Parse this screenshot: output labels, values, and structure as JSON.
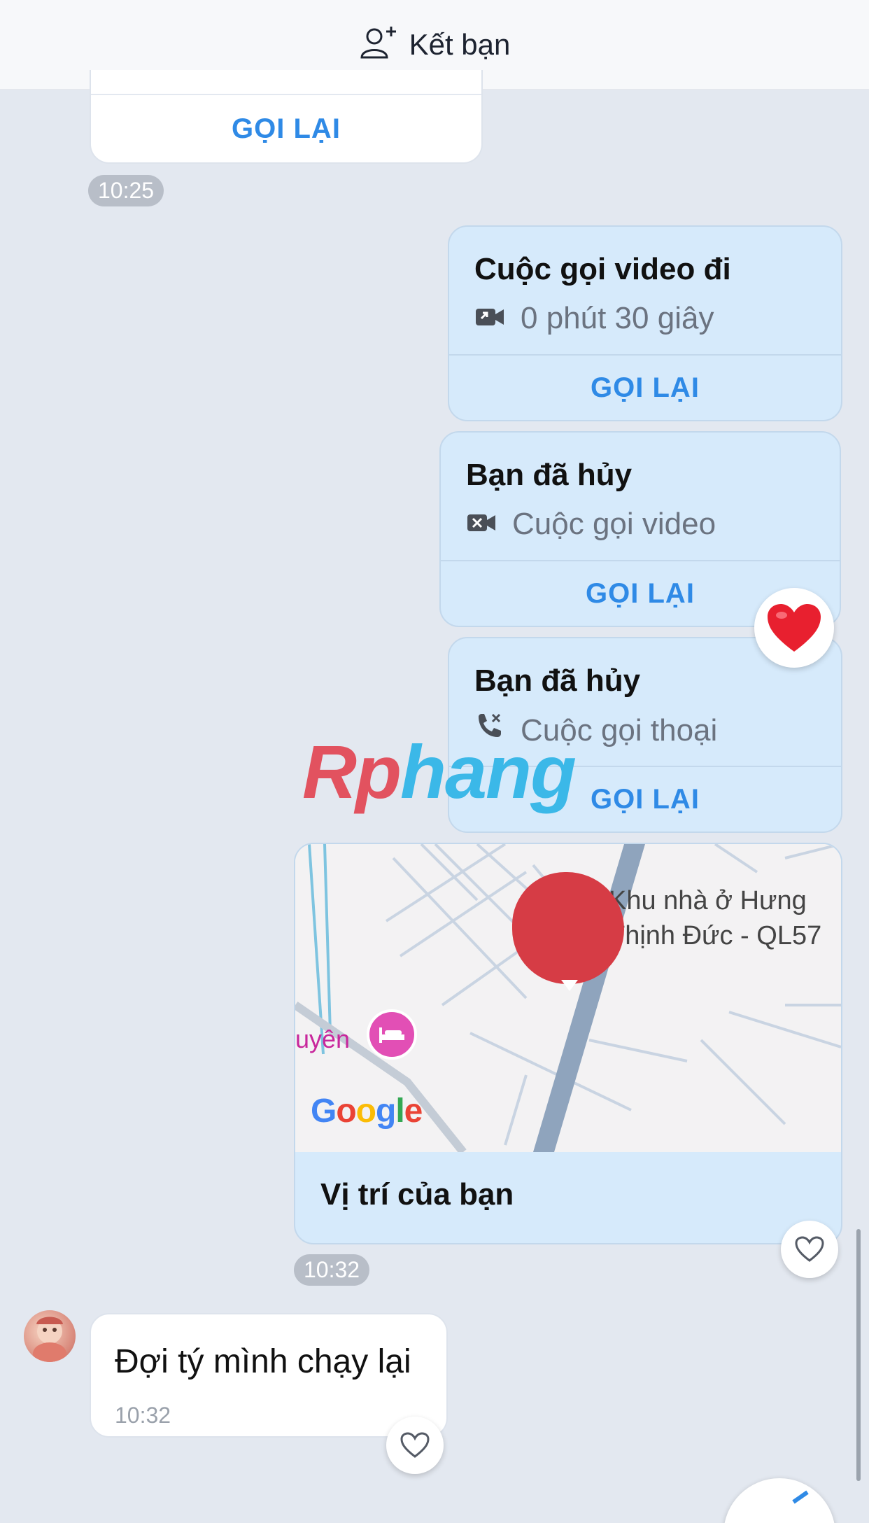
{
  "header": {
    "add_friend_label": "Kết bạn"
  },
  "messages": {
    "prev_call": {
      "callback": "GỌI LẠI",
      "time": "10:25"
    },
    "video_out": {
      "title": "Cuộc gọi video đi",
      "detail": "0 phút 30 giây",
      "callback": "GỌI LẠI"
    },
    "cancel_video": {
      "title": "Bạn đã hủy",
      "detail": "Cuộc gọi video",
      "callback": "GỌI LẠI",
      "reaction": "heart"
    },
    "cancel_voice": {
      "title": "Bạn đã hủy",
      "detail": "Cuộc gọi thoại",
      "callback": "GỌI LẠI"
    },
    "location": {
      "place_label_1": "Khu nhà ở Hưng",
      "place_label_2": "Thịnh Đức - QL57",
      "poi_label": "uyên",
      "google_logo": "Google",
      "caption": "Vị trí của bạn",
      "time": "10:32"
    },
    "incoming": {
      "text": "Đợi tý mình chạy lại",
      "time": "10:32"
    }
  },
  "watermark": {
    "part1": "Rp",
    "part2": "hang"
  },
  "colors": {
    "accent": "#2f8ae6",
    "sent_bubble": "#d6eafb",
    "background": "#e3e8f0",
    "heart": "#e8202f"
  }
}
